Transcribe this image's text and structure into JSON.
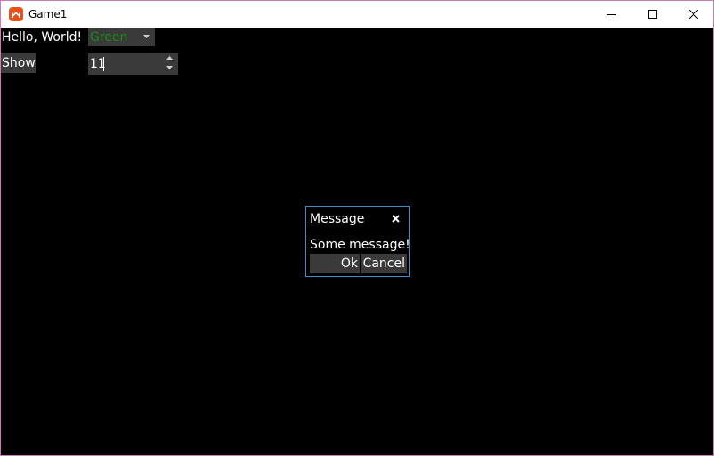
{
  "window": {
    "title": "Game1",
    "icon": "monogame-app-icon",
    "controls": [
      "minimize-icon",
      "maximize-icon",
      "close-icon"
    ]
  },
  "main": {
    "hello_label": "Hello, World!",
    "combo": {
      "selected": "Green",
      "selected_color": "#1d8a1d"
    },
    "show_button": "Show",
    "spin": {
      "value": "11"
    }
  },
  "dialog": {
    "title": "Message",
    "message": "Some message!",
    "ok_label": "Ok",
    "cancel_label": "Cancel",
    "border_color": "#3a8fd0"
  },
  "colors": {
    "background": "#000000",
    "widget": "#3a3a3a",
    "text": "#ffffff"
  }
}
